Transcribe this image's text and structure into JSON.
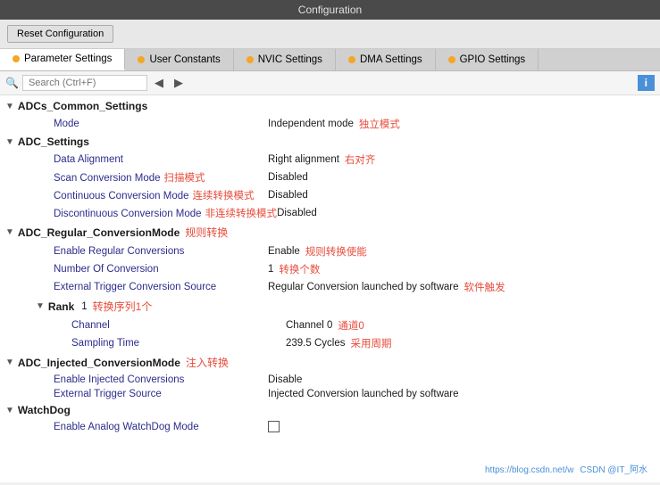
{
  "titleBar": {
    "title": "Configuration"
  },
  "toolbar": {
    "resetLabel": "Reset Configuration"
  },
  "tabs": [
    {
      "id": "parameter",
      "label": "Parameter Settings",
      "active": true,
      "dotColor": "orange"
    },
    {
      "id": "user",
      "label": "User Constants",
      "active": false,
      "dotColor": "orange"
    },
    {
      "id": "nvic",
      "label": "NVIC Settings",
      "active": false,
      "dotColor": "orange"
    },
    {
      "id": "dma",
      "label": "DMA Settings",
      "active": false,
      "dotColor": "orange"
    },
    {
      "id": "gpio",
      "label": "GPIO Settings",
      "active": false,
      "dotColor": "orange"
    }
  ],
  "search": {
    "placeholder": "Search (Ctrl+F)"
  },
  "infoBtn": "i",
  "sections": [
    {
      "id": "adcs-common",
      "title": "ADCs_Common_Settings",
      "titleCn": "",
      "expanded": true,
      "rows": [
        {
          "label": "Mode",
          "labelCn": "",
          "value": "Independent mode",
          "valueCn": "独立模式",
          "indent": 2
        }
      ]
    },
    {
      "id": "adc-settings",
      "title": "ADC_Settings",
      "titleCn": "",
      "expanded": true,
      "rows": [
        {
          "label": "Data Alignment",
          "labelCn": "",
          "value": "Right alignment",
          "valueCn": "右对齐",
          "indent": 2
        },
        {
          "label": "Scan Conversion Mode",
          "labelCn": "扫描模式",
          "value": "Disabled",
          "valueCn": "",
          "indent": 2
        },
        {
          "label": "Continuous Conversion Mode",
          "labelCn": "连续转换模式",
          "value": "Disabled",
          "valueCn": "",
          "indent": 2
        },
        {
          "label": "Discontinuous Conversion Mode",
          "labelCn": "非连续转换模式",
          "value": "Disabled",
          "valueCn": "",
          "indent": 2
        }
      ]
    },
    {
      "id": "adc-regular",
      "title": "ADC_Regular_ConversionMode",
      "titleCn": "规则转换",
      "expanded": true,
      "rows": [
        {
          "label": "Enable Regular Conversions",
          "labelCn": "",
          "value": "Enable",
          "valueCn": "规则转换使能",
          "indent": 2
        },
        {
          "label": "Number Of Conversion",
          "labelCn": "",
          "value": "1",
          "valueCn": "转换个数",
          "indent": 2
        },
        {
          "label": "External Trigger Conversion Source",
          "labelCn": "",
          "value": "Regular Conversion launched by software",
          "valueCn": "软件触发",
          "indent": 2
        }
      ]
    },
    {
      "id": "rank",
      "title": "Rank",
      "titleCn": "",
      "expanded": true,
      "isSubSection": true,
      "rows": [
        {
          "label": "Channel",
          "labelCn": "",
          "value": "Channel 0",
          "valueCn": "通道0",
          "indent": 3
        },
        {
          "label": "Sampling Time",
          "labelCn": "",
          "value": "239.5 Cycles",
          "valueCn": "采用周期",
          "indent": 3
        }
      ],
      "rankValue": "1",
      "rankCn": "转换序列1个"
    },
    {
      "id": "adc-injected",
      "title": "ADC_Injected_ConversionMode",
      "titleCn": "注入转换",
      "expanded": true,
      "rows": [
        {
          "label": "Enable Injected Conversions",
          "labelCn": "",
          "value": "Disable",
          "valueCn": "",
          "indent": 2
        },
        {
          "label": "External Trigger Source",
          "labelCn": "",
          "value": "Injected Conversion launched by software",
          "valueCn": "",
          "indent": 2
        }
      ]
    },
    {
      "id": "watchdog",
      "title": "WatchDog",
      "titleCn": "",
      "expanded": true,
      "rows": [
        {
          "label": "Enable Analog WatchDog Mode",
          "labelCn": "",
          "value": "checkbox",
          "valueCn": "",
          "indent": 2
        }
      ]
    }
  ],
  "watermark": {
    "url": "https://blog.csdn.net/w",
    "author": "CSDN @IT_阿水"
  }
}
